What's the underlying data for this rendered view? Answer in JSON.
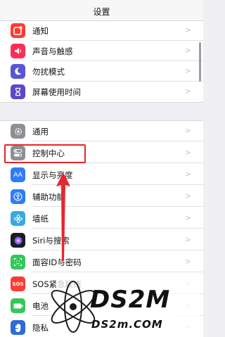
{
  "header": {
    "title": "设置"
  },
  "group1": [
    {
      "label": "通知",
      "icon": "notification-icon",
      "color": "#ff3b30"
    },
    {
      "label": "声音与触感",
      "icon": "sound-icon",
      "color": "#ff2d55"
    },
    {
      "label": "勿扰模式",
      "icon": "moon-icon",
      "color": "#5856d6"
    },
    {
      "label": "屏幕使用时间",
      "icon": "hourglass-icon",
      "color": "#5b49c7"
    }
  ],
  "group2": [
    {
      "label": "通用",
      "icon": "gear-icon",
      "color": "#8e8e93"
    },
    {
      "label": "控制中心",
      "icon": "toggle-icon",
      "color": "#8e8e93"
    },
    {
      "label": "显示与亮度",
      "icon": "text-size-icon",
      "color": "#2f7cf6",
      "glyph": "AA"
    },
    {
      "label": "辅助功能",
      "icon": "accessibility-icon",
      "color": "#2f7cf6"
    },
    {
      "label": "墙纸",
      "icon": "flower-icon",
      "color": "#39a9e0"
    },
    {
      "label": "Siri与搜索",
      "icon": "siri-icon",
      "color": "#1c1c1e"
    },
    {
      "label": "面容ID与密码",
      "icon": "face-id-icon",
      "color": "#34c759"
    },
    {
      "label": "SOS紧急联络",
      "icon": "sos-icon",
      "color": "#ff3b30",
      "glyph": "SOS"
    },
    {
      "label": "电池",
      "icon": "battery-icon",
      "color": "#34c759"
    },
    {
      "label": "隐私",
      "icon": "hand-icon",
      "color": "#2f6bd6"
    }
  ],
  "watermark": {
    "brand": "DS2M",
    "url": "DS2m.COM"
  }
}
